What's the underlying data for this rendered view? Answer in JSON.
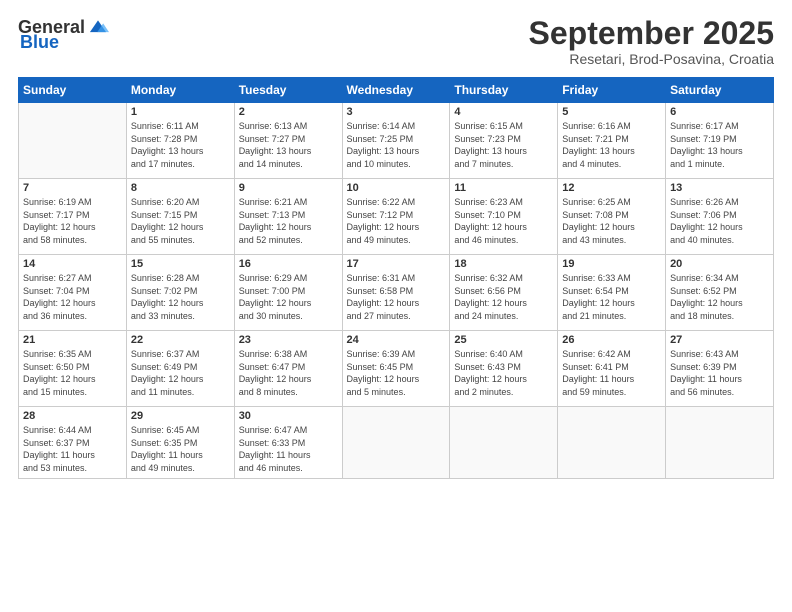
{
  "header": {
    "logo_general": "General",
    "logo_blue": "Blue",
    "month_title": "September 2025",
    "subtitle": "Resetari, Brod-Posavina, Croatia"
  },
  "weekdays": [
    "Sunday",
    "Monday",
    "Tuesday",
    "Wednesday",
    "Thursday",
    "Friday",
    "Saturday"
  ],
  "weeks": [
    [
      {
        "day": "",
        "info": ""
      },
      {
        "day": "1",
        "info": "Sunrise: 6:11 AM\nSunset: 7:28 PM\nDaylight: 13 hours\nand 17 minutes."
      },
      {
        "day": "2",
        "info": "Sunrise: 6:13 AM\nSunset: 7:27 PM\nDaylight: 13 hours\nand 14 minutes."
      },
      {
        "day": "3",
        "info": "Sunrise: 6:14 AM\nSunset: 7:25 PM\nDaylight: 13 hours\nand 10 minutes."
      },
      {
        "day": "4",
        "info": "Sunrise: 6:15 AM\nSunset: 7:23 PM\nDaylight: 13 hours\nand 7 minutes."
      },
      {
        "day": "5",
        "info": "Sunrise: 6:16 AM\nSunset: 7:21 PM\nDaylight: 13 hours\nand 4 minutes."
      },
      {
        "day": "6",
        "info": "Sunrise: 6:17 AM\nSunset: 7:19 PM\nDaylight: 13 hours\nand 1 minute."
      }
    ],
    [
      {
        "day": "7",
        "info": "Sunrise: 6:19 AM\nSunset: 7:17 PM\nDaylight: 12 hours\nand 58 minutes."
      },
      {
        "day": "8",
        "info": "Sunrise: 6:20 AM\nSunset: 7:15 PM\nDaylight: 12 hours\nand 55 minutes."
      },
      {
        "day": "9",
        "info": "Sunrise: 6:21 AM\nSunset: 7:13 PM\nDaylight: 12 hours\nand 52 minutes."
      },
      {
        "day": "10",
        "info": "Sunrise: 6:22 AM\nSunset: 7:12 PM\nDaylight: 12 hours\nand 49 minutes."
      },
      {
        "day": "11",
        "info": "Sunrise: 6:23 AM\nSunset: 7:10 PM\nDaylight: 12 hours\nand 46 minutes."
      },
      {
        "day": "12",
        "info": "Sunrise: 6:25 AM\nSunset: 7:08 PM\nDaylight: 12 hours\nand 43 minutes."
      },
      {
        "day": "13",
        "info": "Sunrise: 6:26 AM\nSunset: 7:06 PM\nDaylight: 12 hours\nand 40 minutes."
      }
    ],
    [
      {
        "day": "14",
        "info": "Sunrise: 6:27 AM\nSunset: 7:04 PM\nDaylight: 12 hours\nand 36 minutes."
      },
      {
        "day": "15",
        "info": "Sunrise: 6:28 AM\nSunset: 7:02 PM\nDaylight: 12 hours\nand 33 minutes."
      },
      {
        "day": "16",
        "info": "Sunrise: 6:29 AM\nSunset: 7:00 PM\nDaylight: 12 hours\nand 30 minutes."
      },
      {
        "day": "17",
        "info": "Sunrise: 6:31 AM\nSunset: 6:58 PM\nDaylight: 12 hours\nand 27 minutes."
      },
      {
        "day": "18",
        "info": "Sunrise: 6:32 AM\nSunset: 6:56 PM\nDaylight: 12 hours\nand 24 minutes."
      },
      {
        "day": "19",
        "info": "Sunrise: 6:33 AM\nSunset: 6:54 PM\nDaylight: 12 hours\nand 21 minutes."
      },
      {
        "day": "20",
        "info": "Sunrise: 6:34 AM\nSunset: 6:52 PM\nDaylight: 12 hours\nand 18 minutes."
      }
    ],
    [
      {
        "day": "21",
        "info": "Sunrise: 6:35 AM\nSunset: 6:50 PM\nDaylight: 12 hours\nand 15 minutes."
      },
      {
        "day": "22",
        "info": "Sunrise: 6:37 AM\nSunset: 6:49 PM\nDaylight: 12 hours\nand 11 minutes."
      },
      {
        "day": "23",
        "info": "Sunrise: 6:38 AM\nSunset: 6:47 PM\nDaylight: 12 hours\nand 8 minutes."
      },
      {
        "day": "24",
        "info": "Sunrise: 6:39 AM\nSunset: 6:45 PM\nDaylight: 12 hours\nand 5 minutes."
      },
      {
        "day": "25",
        "info": "Sunrise: 6:40 AM\nSunset: 6:43 PM\nDaylight: 12 hours\nand 2 minutes."
      },
      {
        "day": "26",
        "info": "Sunrise: 6:42 AM\nSunset: 6:41 PM\nDaylight: 11 hours\nand 59 minutes."
      },
      {
        "day": "27",
        "info": "Sunrise: 6:43 AM\nSunset: 6:39 PM\nDaylight: 11 hours\nand 56 minutes."
      }
    ],
    [
      {
        "day": "28",
        "info": "Sunrise: 6:44 AM\nSunset: 6:37 PM\nDaylight: 11 hours\nand 53 minutes."
      },
      {
        "day": "29",
        "info": "Sunrise: 6:45 AM\nSunset: 6:35 PM\nDaylight: 11 hours\nand 49 minutes."
      },
      {
        "day": "30",
        "info": "Sunrise: 6:47 AM\nSunset: 6:33 PM\nDaylight: 11 hours\nand 46 minutes."
      },
      {
        "day": "",
        "info": ""
      },
      {
        "day": "",
        "info": ""
      },
      {
        "day": "",
        "info": ""
      },
      {
        "day": "",
        "info": ""
      }
    ]
  ]
}
